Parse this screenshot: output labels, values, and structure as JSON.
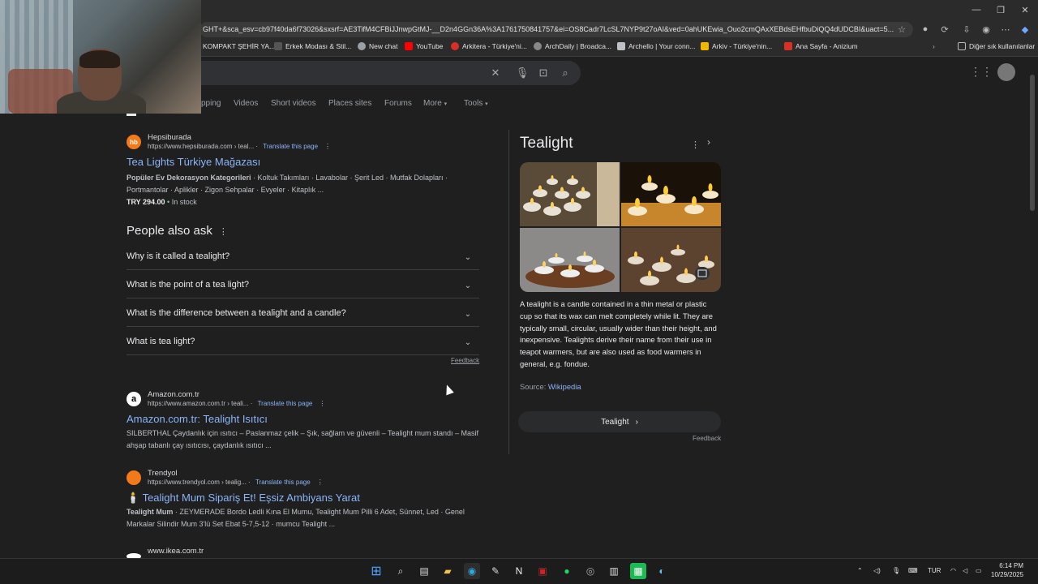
{
  "browser": {
    "url": "GHT+&sca_esv=cb97f40da6f73026&sxsrf=AE3TifM4CFBiJJnwpGtMJ-__D2n4GGn36A%3A1761750841757&ei=OS8Cadr7LcSL7NYP9t27oAI&ved=0ahUKEwia_Ouo2cmQAxXEBdsEHfbuDiQQ4dUDCBI&uact=5...",
    "bookmarks": [
      {
        "label": "KOMPAKT ŞEHİR YA...",
        "color": "#e3a33a"
      },
      {
        "label": "Erkek Modası & Stil...",
        "color": "#222222"
      },
      {
        "label": "New chat",
        "color": "#9aa0a6"
      },
      {
        "label": "YouTube",
        "color": "#ff0000"
      },
      {
        "label": "Arkitera - Türkiye'ni...",
        "color": "#d93025"
      },
      {
        "label": "ArchDaily | Broadca...",
        "color": "#888888"
      },
      {
        "label": "Archello | Your conn...",
        "color": "#bdc1c6"
      },
      {
        "label": "Arkiv - Türkiye'nin...",
        "color": "#f2b600"
      },
      {
        "label": "Ana Sayfa - Anizium",
        "color": "#d93025"
      }
    ],
    "other_bookmarks": "Diğer sık kullanılanlar"
  },
  "tabs": [
    "pping",
    "Videos",
    "Short videos",
    "Places sites",
    "Forums",
    "More",
    "Tools"
  ],
  "results": [
    {
      "site": "Hepsiburada",
      "cite": "https://www.hepsiburada.com › teal...",
      "translate": "Translate this page",
      "title": "Tea Lights Türkiye Mağazası",
      "snippet_bold": "Popüler Ev Dekorasyon Kategorileri",
      "snippet": " · Koltuk Takımları · Lavabolar · Şerit Led · Mutfak Dolapları · Portmantolar · Aplikler · Zigon Sehpalar · Evyeler · Kitaplık ...",
      "price": "TRY 294.00",
      "stock": "In stock",
      "fav_color": "#f27a1a",
      "fav_text": "hb"
    },
    {
      "site": "Amazon.com.tr",
      "cite": "https://www.amazon.com.tr › teali...",
      "translate": "Translate this page",
      "title": "Amazon.com.tr: Tealight Isıtıcı",
      "snippet": "SILBERTHAL Çaydanlık için ısıtıcı – Paslanmaz çelik – Şık, sağlam ve güvenli – Tealight mum standı – Masif ahşap tabanlı çay ısıtıcısı, çaydanlık ısıtıcı ...",
      "fav_color": "#ffffff",
      "fav_text": "a"
    },
    {
      "site": "Trendyol",
      "cite": "https://www.trendyol.com › tealig...",
      "translate": "Translate this page",
      "title": "🕯️ Tealight Mum Sipariş Et! Eşsiz Ambiyans Yarat",
      "snippet_bold": "Tealight Mum",
      "snippet": " · ZEYMERADE Bordo Ledli Kına El Mumu, Tealight Mum Pilli 6 Adet, Sünnet, Led · Genel Markalar Silindir Mum 3'lü Set Ebat 5-7,5-12 · mumcu Tealight ...",
      "fav_color": "#f27a1a",
      "fav_text": ""
    },
    {
      "site": "www.ikea.com.tr"
    }
  ],
  "paa": {
    "heading": "People also ask",
    "questions": [
      "Why is it called a tealight?",
      "What is the point of a tea light?",
      "What is the difference between a tealight and a candle?",
      "What is tea light?"
    ],
    "feedback": "Feedback"
  },
  "knowledge_panel": {
    "title": "Tealight",
    "description": "A tealight is a candle contained in a thin metal or plastic cup so that its wax can melt completely while lit. They are typically small, circular, usually wider than their height, and inexpensive. Tealights derive their name from their use in teapot warmers, but are also used as food warmers in general, e.g. fondue.",
    "source_label": "Source:",
    "source_link": "Wikipedia",
    "button": "Tealight",
    "feedback": "Feedback"
  },
  "system": {
    "lang": "TUR",
    "time": "6:14 PM",
    "date": "10/29/2025"
  }
}
